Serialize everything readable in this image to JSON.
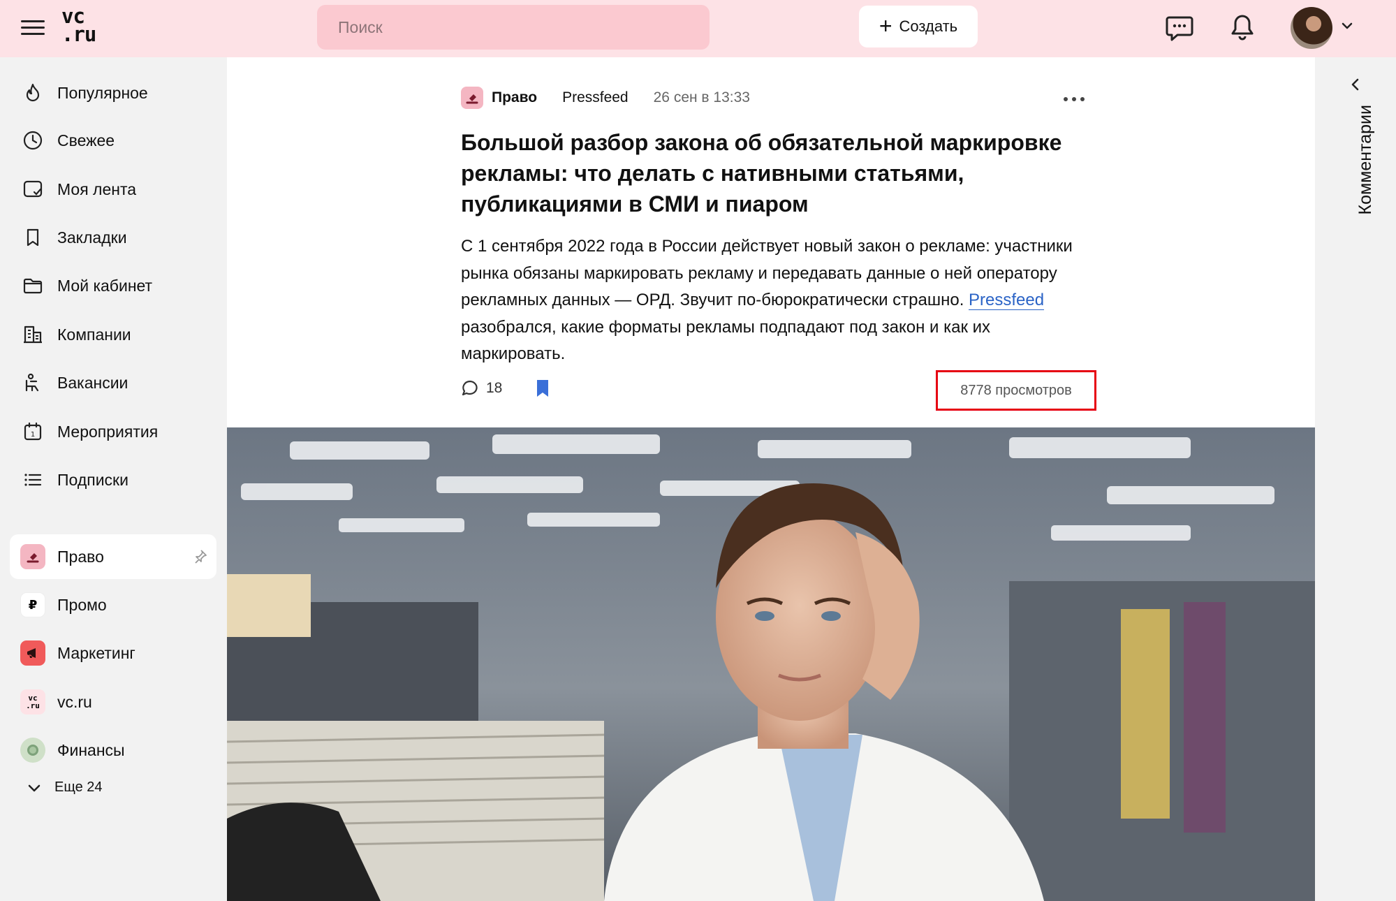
{
  "header": {
    "logo_line1": "vc",
    "logo_line2": ".ru",
    "search_placeholder": "Поиск",
    "create_label": "Создать",
    "icons": [
      "menu-icon",
      "messages-icon",
      "bell-icon",
      "chevron-down-icon"
    ]
  },
  "sidebar": {
    "nav": [
      {
        "label": "Популярное",
        "icon": "fire-icon"
      },
      {
        "label": "Свежее",
        "icon": "clock-icon"
      },
      {
        "label": "Моя лента",
        "icon": "feed-icon"
      },
      {
        "label": "Закладки",
        "icon": "bookmark-icon"
      },
      {
        "label": "Мой кабинет",
        "icon": "folder-icon"
      },
      {
        "label": "Компании",
        "icon": "building-icon"
      },
      {
        "label": "Вакансии",
        "icon": "chair-icon"
      },
      {
        "label": "Мероприятия",
        "icon": "calendar-icon"
      },
      {
        "label": "Подписки",
        "icon": "list-icon"
      }
    ],
    "subsites": [
      {
        "label": "Право",
        "icon": "gavel-icon",
        "color": "#f4b6c2"
      },
      {
        "label": "Промо",
        "icon": "ruble-icon",
        "color": "#ffffff"
      },
      {
        "label": "Маркетинг",
        "icon": "megaphone-icon",
        "color": "#f05a5a"
      },
      {
        "label": "vc.ru",
        "icon": "vc-logo-icon",
        "color": "#fde2e6"
      },
      {
        "label": "Финансы",
        "icon": "coin-icon",
        "color": "#cfe0c8"
      }
    ],
    "more_label": "Еще 24"
  },
  "article": {
    "category": "Право",
    "author": "Pressfeed",
    "date": "26 сен в 13:33",
    "title": "Большой разбор закона об обязательной маркировке рекламы: что делать с нативными статьями, публикациями в СМИ и пиаром",
    "lead_before": "С 1 сентября 2022 года в России действует новый закон о рекламе: участники рынка обязаны маркировать рекламу и передавать данные о ней оператору рекламных данных — ОРД. Звучит по-бюрократически страшно. ",
    "lead_link": "Pressfeed",
    "lead_after": " разобрался, какие форматы рекламы подпадают под закон и как их маркировать.",
    "comments_count": "18",
    "views": "8778 просмотров",
    "highlight_color": "#e60012"
  },
  "rail": {
    "label": "Комментарии"
  },
  "colors": {
    "header_bg": "#fde2e6",
    "search_bg": "#fbc9d0",
    "link": "#2a63c6",
    "bookmark": "#3a6fd8"
  }
}
